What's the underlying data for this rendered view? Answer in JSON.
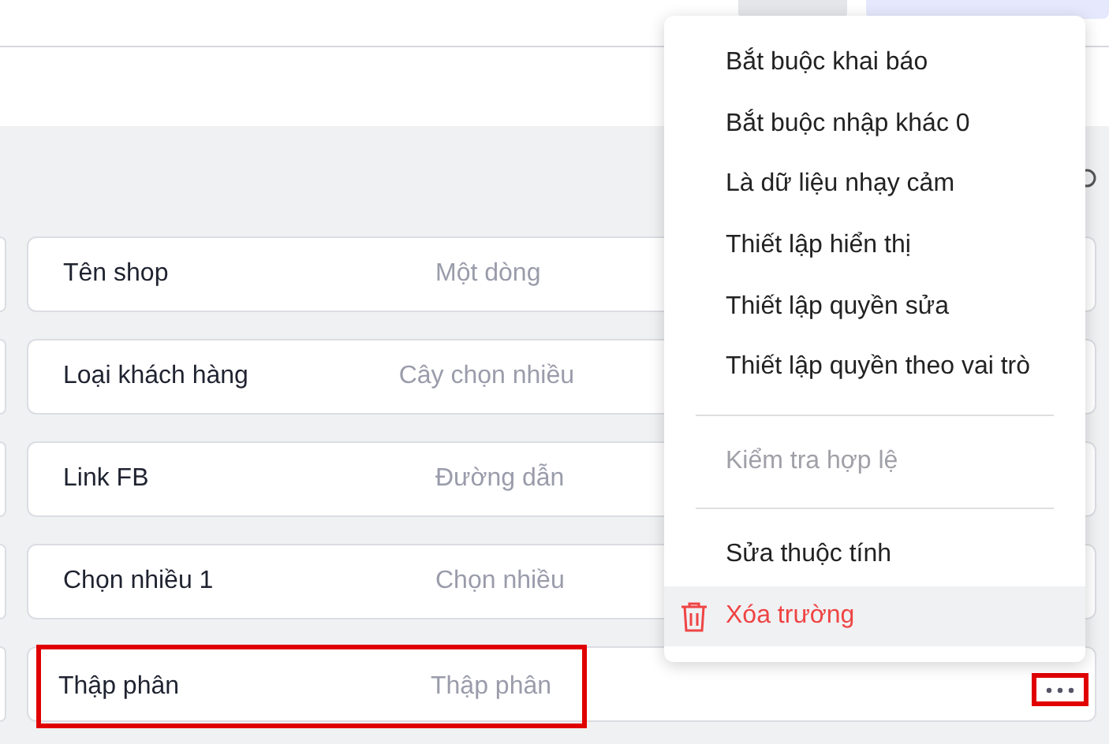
{
  "header": {
    "buttons": [
      {
        "kind": "secondary"
      },
      {
        "kind": "primary"
      }
    ]
  },
  "fields": [
    {
      "name": "Tên shop",
      "type": "Một dòng",
      "highlighted": false
    },
    {
      "name": "Loại khách hàng",
      "type": "Cây chọn nhiều",
      "highlighted": false
    },
    {
      "name": "Link FB",
      "type": "Đường dẫn",
      "highlighted": false
    },
    {
      "name": "Chọn nhiều 1",
      "type": "Chọn nhiều",
      "highlighted": false
    },
    {
      "name": "Thập phân",
      "type": "Thập phân",
      "highlighted": true
    }
  ],
  "menu": [
    {
      "kind": "item",
      "label": "Bắt buộc khai báo",
      "disabled": false,
      "hovered": false
    },
    {
      "kind": "item",
      "label": "Bắt buộc nhập khác 0",
      "disabled": false,
      "hovered": false
    },
    {
      "kind": "item",
      "label": "Là dữ liệu nhạy cảm",
      "disabled": false,
      "hovered": false
    },
    {
      "kind": "item",
      "label": "Thiết lập hiển thị",
      "disabled": false,
      "hovered": false
    },
    {
      "kind": "item",
      "label": "Thiết lập quyền sửa",
      "disabled": false,
      "hovered": false
    },
    {
      "kind": "item",
      "label": "Thiết lập quyền theo vai trò",
      "disabled": false,
      "hovered": false
    },
    {
      "kind": "divider"
    },
    {
      "kind": "item",
      "label": "Kiểm tra hợp lệ",
      "disabled": true,
      "hovered": false
    },
    {
      "kind": "divider"
    },
    {
      "kind": "item",
      "label": "Sửa thuộc tính",
      "disabled": false,
      "hovered": false
    },
    {
      "kind": "danger",
      "label": "Xóa trường",
      "disabled": false,
      "hovered": true
    }
  ]
}
